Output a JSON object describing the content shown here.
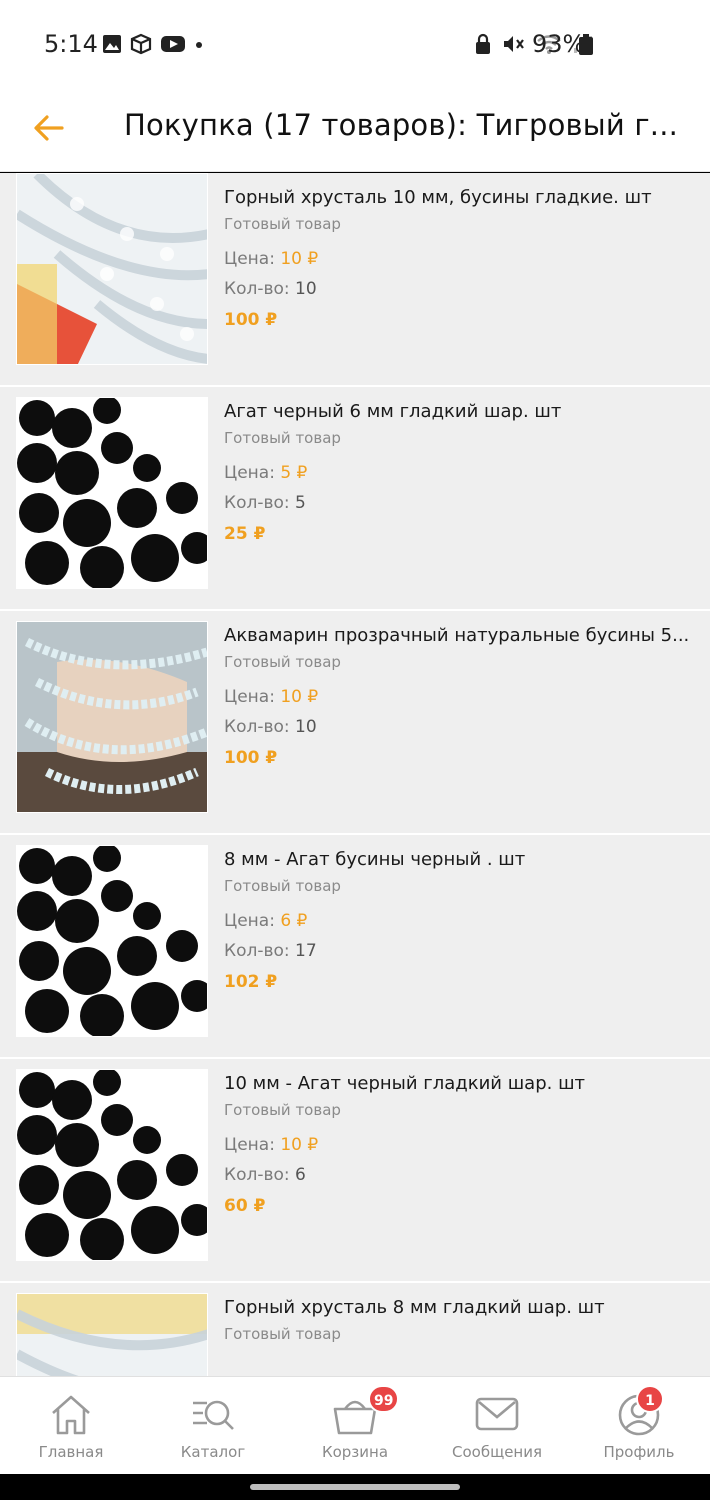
{
  "status_bar": {
    "time": "5:14",
    "battery": "93%"
  },
  "header": {
    "title": "Покупка (17 товаров): Тигровый г..."
  },
  "labels": {
    "price": "Цена:",
    "qty": "Кол-во:"
  },
  "items": [
    {
      "name": "Горный хрусталь 10 мм, бусины гладкие. шт",
      "status": "Готовый товар",
      "price": "10 ₽",
      "qty": "10",
      "total": "100 ₽"
    },
    {
      "name": "Агат черный 6 мм  гладкий шар. шт",
      "status": "Готовый товар",
      "price": "5 ₽",
      "qty": "5",
      "total": "25 ₽"
    },
    {
      "name": "Аквамарин прозрачный натуральные бусины 5...",
      "status": "Готовый товар",
      "price": "10 ₽",
      "qty": "10",
      "total": "100 ₽"
    },
    {
      "name": "8 мм - Агат бусины черный . шт",
      "status": "Готовый товар",
      "price": "6 ₽",
      "qty": "17",
      "total": "102 ₽"
    },
    {
      "name": "10 мм - Агат черный гладкий шар. шт",
      "status": "Готовый товар",
      "price": "10 ₽",
      "qty": "6",
      "total": "60 ₽"
    },
    {
      "name": "Горный хрусталь 8 мм гладкий шар. шт",
      "status": "Готовый товар"
    }
  ],
  "tabs": [
    {
      "label": "Главная",
      "icon": "home-icon"
    },
    {
      "label": "Каталог",
      "icon": "catalog-search-icon"
    },
    {
      "label": "Корзина",
      "icon": "basket-icon",
      "badge": "99"
    },
    {
      "label": "Сообщения",
      "icon": "envelope-icon"
    },
    {
      "label": "Профиль",
      "icon": "profile-icon",
      "badge": "1"
    }
  ],
  "colors": {
    "accent": "#f0a020",
    "badge": "#e84545"
  }
}
